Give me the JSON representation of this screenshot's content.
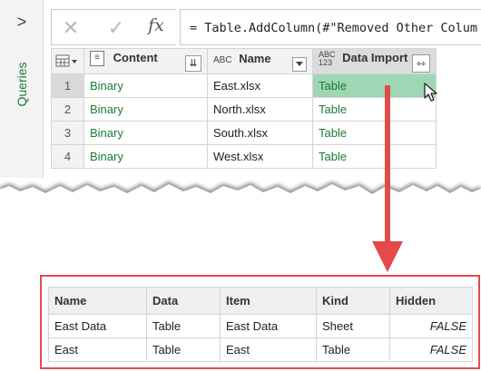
{
  "queries_pane": {
    "collapse_glyph": ">",
    "label": "Queries"
  },
  "formula_bar": {
    "cancel_glyph": "✕",
    "confirm_glyph": "✓",
    "fx_label": "fx",
    "formula": "= Table.AddColumn(#\"Removed Other Colum"
  },
  "source_table": {
    "columns": [
      {
        "name": "Content",
        "type_glyph": "≡",
        "filter_glyph": "⇊"
      },
      {
        "name": "Name",
        "type_glyph": "ABC"
      },
      {
        "name": "Data Import",
        "type_glyph_top": "ABC",
        "type_glyph_bottom": "123",
        "expand_glyph": "⇿"
      }
    ],
    "rows": [
      {
        "num": "1",
        "content": "Binary",
        "name": "East.xlsx",
        "data": "Table"
      },
      {
        "num": "2",
        "content": "Binary",
        "name": "North.xlsx",
        "data": "Table"
      },
      {
        "num": "3",
        "content": "Binary",
        "name": "South.xlsx",
        "data": "Table"
      },
      {
        "num": "4",
        "content": "Binary",
        "name": "West.xlsx",
        "data": "Table"
      }
    ]
  },
  "result_table": {
    "columns": [
      "Name",
      "Data",
      "Item",
      "Kind",
      "Hidden"
    ],
    "rows": [
      [
        "East Data",
        "Table",
        "East Data",
        "Sheet",
        "FALSE"
      ],
      [
        "East",
        "Table",
        "East",
        "Table",
        "FALSE"
      ]
    ]
  },
  "colors": {
    "accent_green": "#1a7b36",
    "selection": "#9fd6b4",
    "arrow_red": "#e34a4a"
  }
}
